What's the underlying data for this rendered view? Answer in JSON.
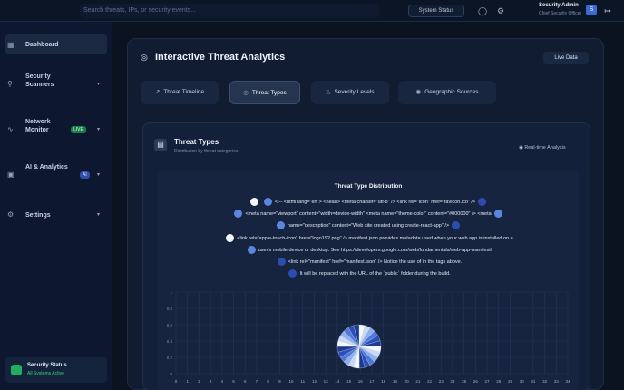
{
  "header": {
    "search_placeholder": "Search threats, IPs, or security events...",
    "system_status_label": "System Status",
    "user_name": "Security Admin",
    "user_role": "Chief Security Officer",
    "avatar_initial": "S"
  },
  "sidebar": {
    "items": [
      {
        "label": "Dashboard",
        "active": true
      },
      {
        "label": "Security Scanners"
      },
      {
        "label": "Network Monitor",
        "badge": "LIVE"
      },
      {
        "label": "AI & Analytics",
        "badge": "AI"
      },
      {
        "label": "Settings"
      }
    ],
    "status": {
      "title": "Security Status",
      "sub": "All Systems Active"
    }
  },
  "panel": {
    "title": "Interactive Threat Analytics",
    "live_button": "Live Data",
    "tabs": [
      {
        "label": "Threat Timeline",
        "icon": "trend-icon"
      },
      {
        "label": "Threat Types",
        "icon": "target-icon",
        "active": true
      },
      {
        "label": "Severity Levels",
        "icon": "warning-icon"
      },
      {
        "label": "Geographic Sources",
        "icon": "globe-icon"
      }
    ]
  },
  "card": {
    "title": "Threat Types",
    "subtitle": "Distribution by threat categories",
    "action": "Real-time Analysis"
  },
  "chart_data": {
    "type": "pie",
    "title": "Threat Type Distribution",
    "legend_lines": [
      "<!-- <html lang=\"en\"> <head> <meta charset=\"utf-8\" /> <link rel=\"icon\" href=\"favicon.ico\" />",
      "<meta name=\"viewport\" content=\"width=device-width\" <meta name=\"theme-color\" content=\"#000000\" /> <meta",
      "name=\"description\" content=\"Web site created using create-react-app\" />",
      "<link rel=\"apple-touch-icon\" href=\"logo192.png\" /> manifest.json provides metadata used when your web app is installed on a",
      "user's mobile device or desktop. See https://developers.google.com/web/fundamentals/web-app-manifest/",
      "<link rel=\"manifest\" href=\"manifest.json\" /> Notice the use of  in the tags above.",
      "It will be replaced with the URL of the `public` folder during the build."
    ],
    "y_ticks": [
      "1",
      "0.8",
      "0.6",
      "0.4",
      "0.2",
      "0"
    ],
    "x_ticks": [
      "0",
      "1",
      "2",
      "3",
      "4",
      "5",
      "6",
      "7",
      "8",
      "9",
      "10",
      "11",
      "12",
      "13",
      "14",
      "15",
      "16",
      "17",
      "18",
      "19",
      "20",
      "21",
      "22",
      "23",
      "24",
      "25",
      "26",
      "27",
      "28",
      "29",
      "30",
      "31",
      "32",
      "33",
      "34"
    ],
    "slices": 24
  }
}
